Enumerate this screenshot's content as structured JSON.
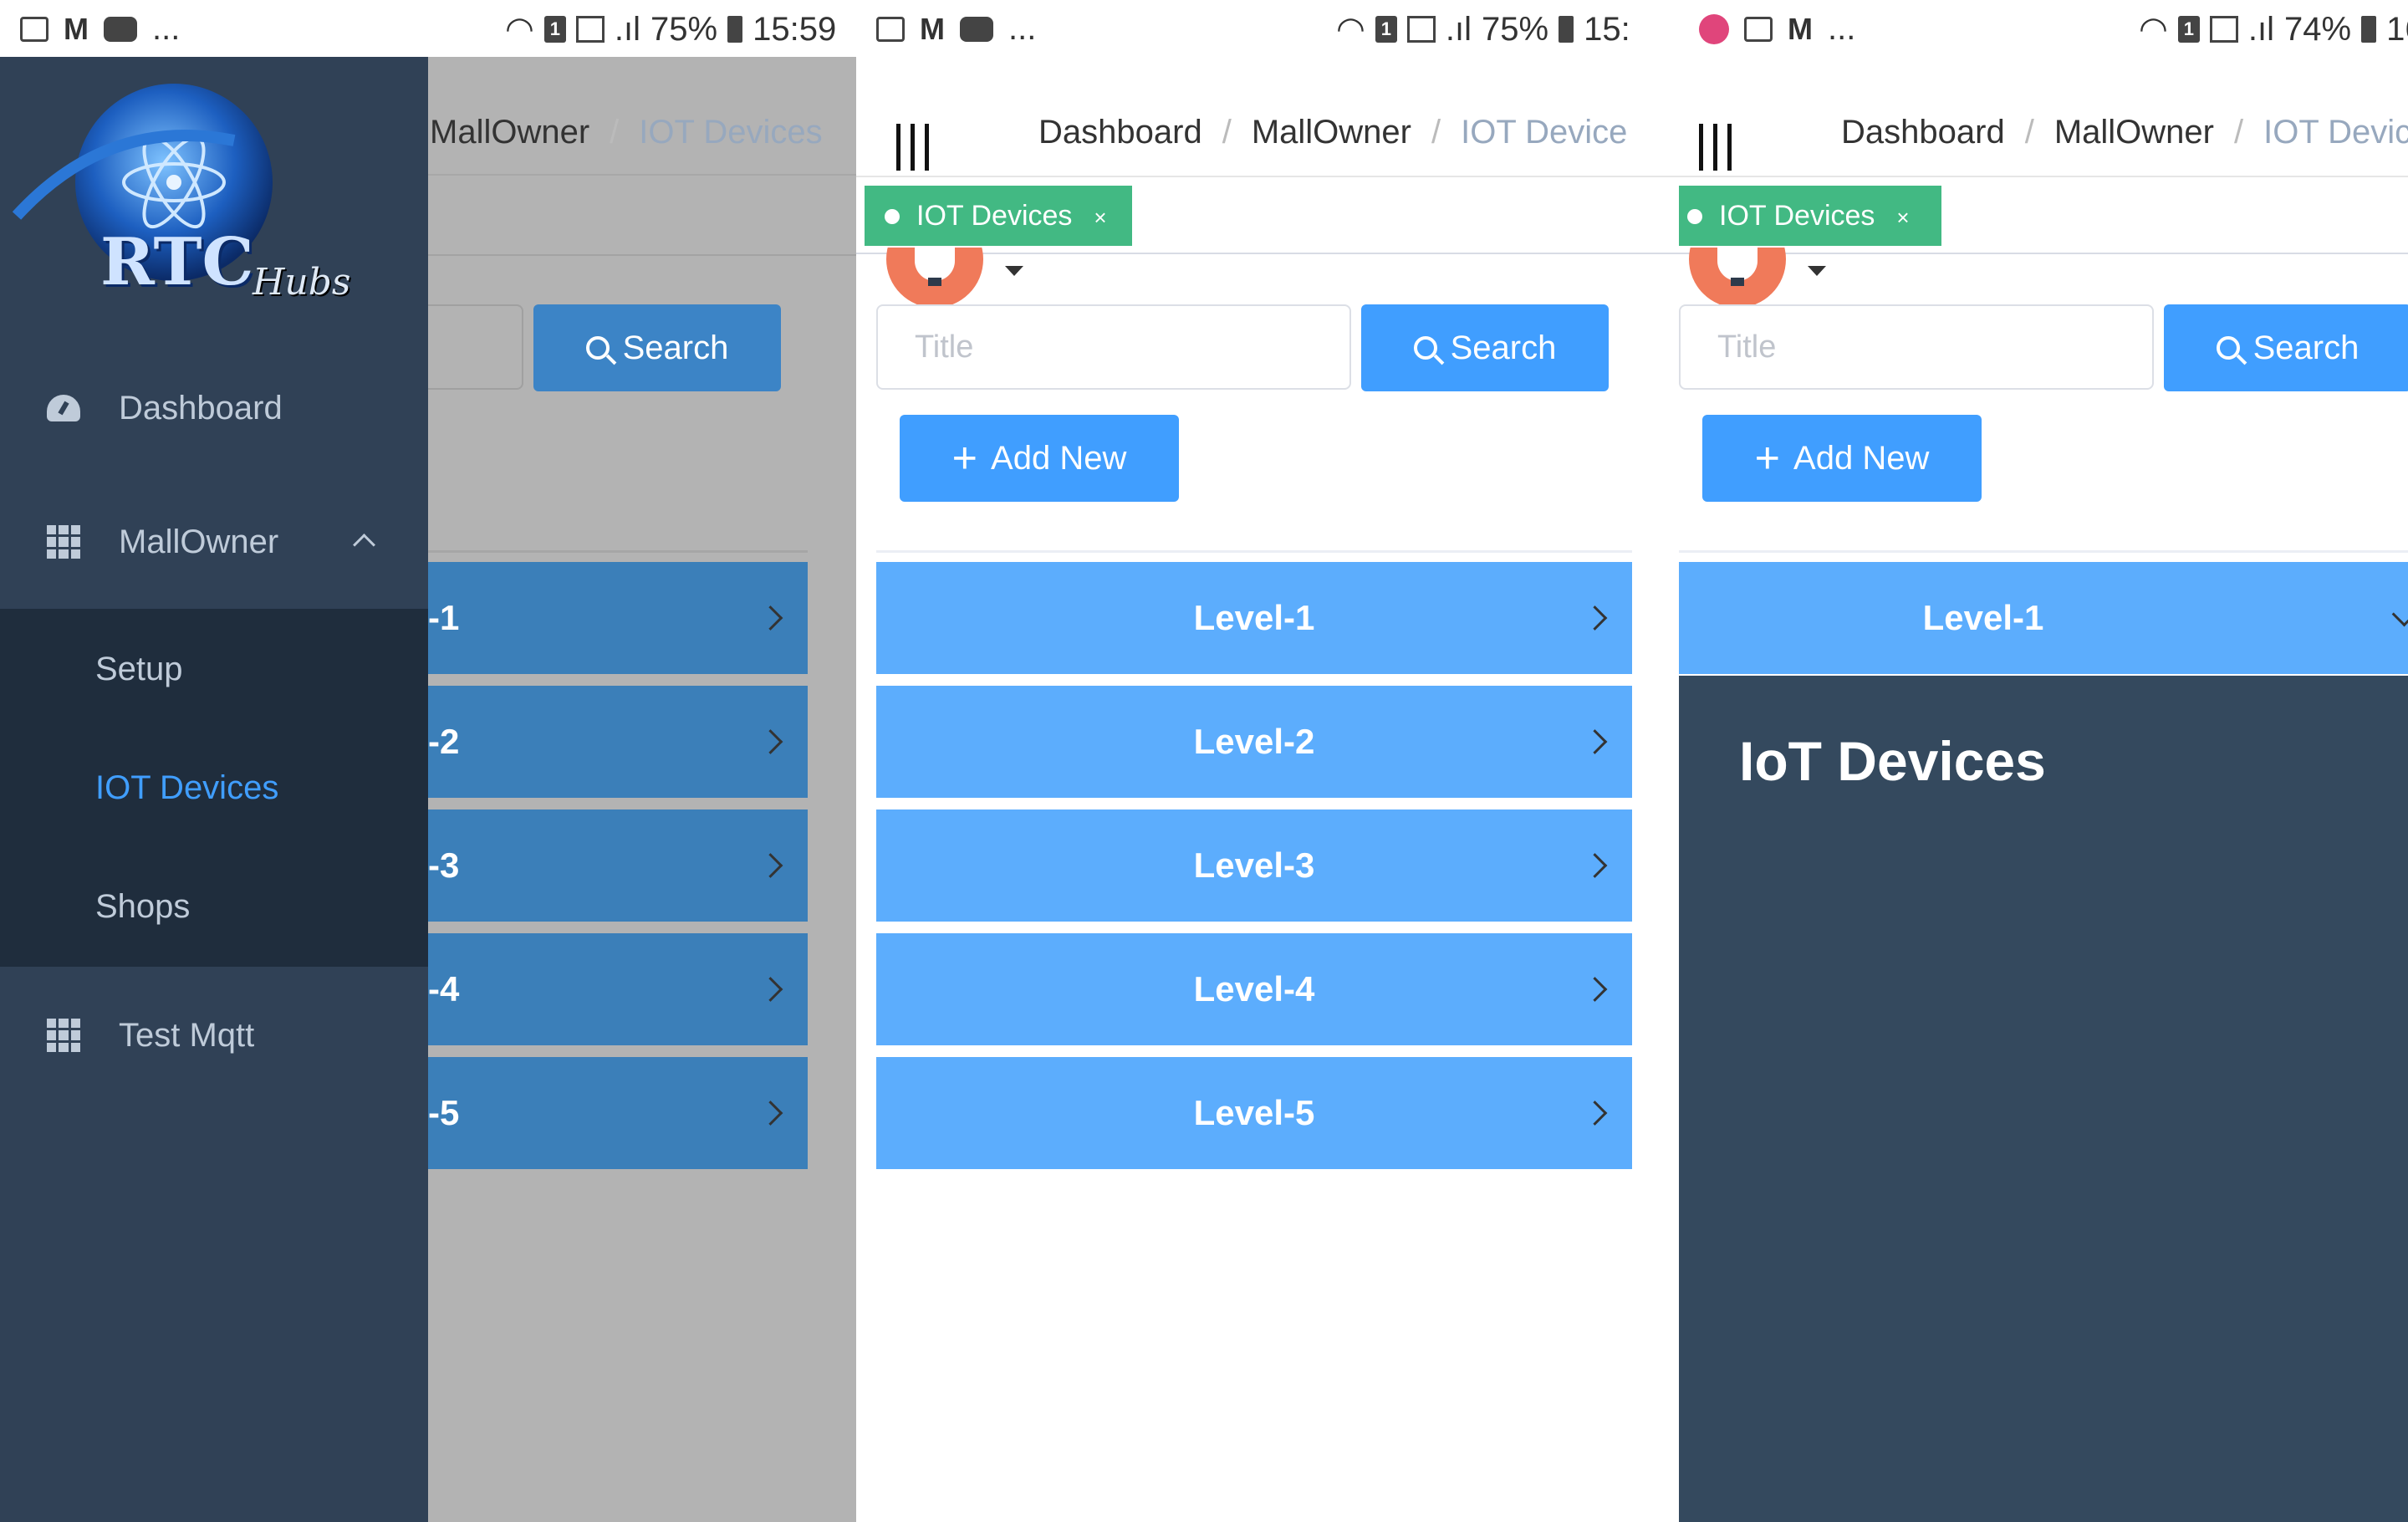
{
  "panels": [
    {
      "status": {
        "battery": "75%",
        "time": "15:59",
        "sim": "1",
        "dots": "..."
      },
      "breadcrumb": [
        "MallOwner",
        "/",
        "IOT Devices"
      ],
      "search_label": "Search",
      "levels": [
        "-1",
        "-2",
        "-3",
        "-4",
        "-5"
      ],
      "sidebar": {
        "logo_text": "RTC",
        "logo_sub": "Hubs",
        "items": [
          {
            "label": "Dashboard",
            "icon": "dashboard-icon"
          },
          {
            "label": "MallOwner",
            "icon": "grid-icon"
          },
          {
            "label": "Test Mqtt",
            "icon": "grid-icon"
          }
        ],
        "submenu": [
          "Setup",
          "IOT Devices",
          "Shops"
        ]
      }
    },
    {
      "status": {
        "battery": "75%",
        "time": "15:",
        "sim": "1",
        "dots": "..."
      },
      "breadcrumb": [
        "Dashboard",
        "/",
        "MallOwner",
        "/",
        "IOT Device"
      ],
      "tag": {
        "label": "IOT Devices",
        "close": "×"
      },
      "title_placeholder": "Title",
      "search_label": "Search",
      "add_label": "Add New",
      "levels": [
        "Level-1",
        "Level-2",
        "Level-3",
        "Level-4",
        "Level-5"
      ]
    },
    {
      "status": {
        "battery": "74%",
        "time": "16",
        "sim": "1",
        "dots": "..."
      },
      "breadcrumb": [
        "Dashboard",
        "/",
        "MallOwner",
        "/",
        "IOT Devic"
      ],
      "tag": {
        "label": "IOT Devices",
        "close": "×"
      },
      "title_placeholder": "Title",
      "search_label": "Search",
      "add_label": "Add New",
      "levels": [
        "Level-1"
      ],
      "expanded_title": "IoT Devices"
    }
  ],
  "colors": {
    "sidebar_bg": "#304156",
    "submenu_bg": "#1f2d3d",
    "active_menu": "#409eff",
    "tag_green": "#42b983",
    "primary_blue": "#409eff",
    "level_blue": "#5cadfd",
    "overlay_gray": "#b3b3b3",
    "expanded_bg": "#34495e"
  }
}
